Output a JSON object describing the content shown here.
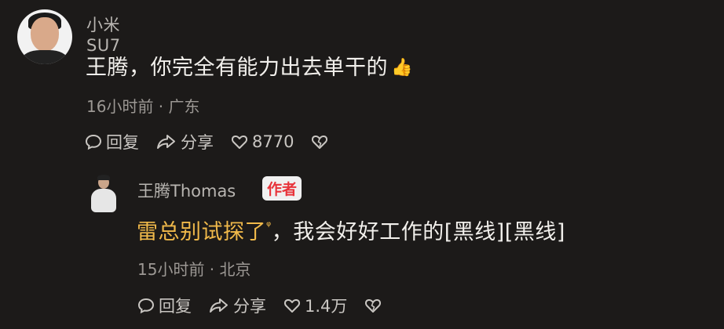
{
  "comment": {
    "username": "小米SU7",
    "text": "王腾，你完全有能力出去单干的",
    "meta": "16小时前 · 广东",
    "reply_label": "回复",
    "share_label": "分享",
    "like_count": "8770",
    "emoji_icon": "thumbs-up-icon"
  },
  "reply": {
    "username": "王腾Thomas",
    "badge": "作者",
    "text_link": "雷总别试探了",
    "text_search_mark": "ᵠ",
    "text_rest": "，我会好好工作的[黑线][黑线]",
    "meta": "15小时前 · 北京",
    "reply_label": "回复",
    "share_label": "分享",
    "like_count": "1.4万"
  },
  "colors": {
    "background": "#1c1a19",
    "link": "#f0b94a",
    "badge_text": "#e8333a"
  }
}
